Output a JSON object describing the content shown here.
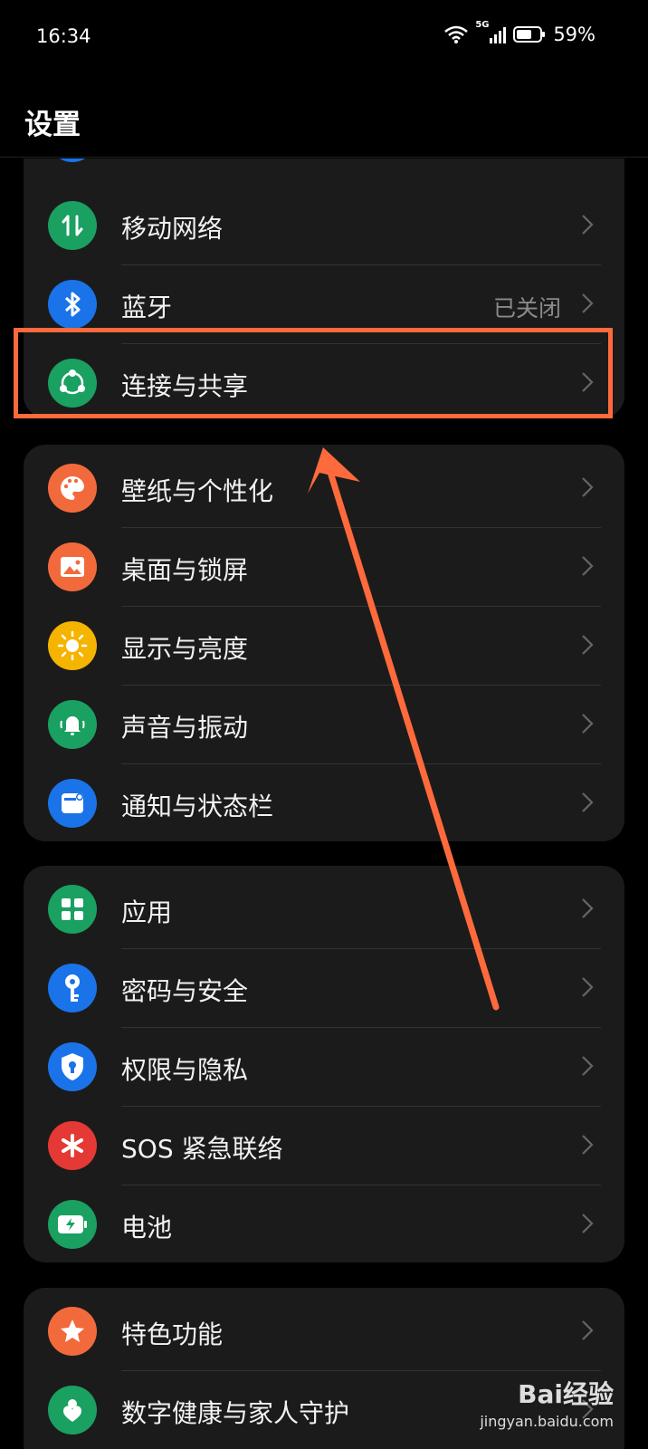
{
  "status_bar": {
    "time": "16:34",
    "network": "5G",
    "battery": "59%"
  },
  "header": {
    "title": "设置"
  },
  "groups": [
    {
      "items": [
        {
          "label": "移动网络",
          "value": "",
          "icon": "mobile-data-icon",
          "color": "#1aa060"
        },
        {
          "label": "蓝牙",
          "value": "已关闭",
          "icon": "bluetooth-icon",
          "color": "#1a73e8"
        },
        {
          "label": "连接与共享",
          "value": "",
          "icon": "share-connection-icon",
          "color": "#1aa060"
        }
      ]
    },
    {
      "items": [
        {
          "label": "壁纸与个性化",
          "icon": "palette-icon",
          "color": "#f26a3c"
        },
        {
          "label": "桌面与锁屏",
          "icon": "picture-icon",
          "color": "#f26a3c"
        },
        {
          "label": "显示与亮度",
          "icon": "sun-icon",
          "color": "#f5b400"
        },
        {
          "label": "声音与振动",
          "icon": "bell-icon",
          "color": "#1aa060"
        },
        {
          "label": "通知与状态栏",
          "icon": "notification-icon",
          "color": "#1a73e8"
        }
      ]
    },
    {
      "items": [
        {
          "label": "应用",
          "icon": "apps-grid-icon",
          "color": "#1aa060"
        },
        {
          "label": "密码与安全",
          "icon": "key-icon",
          "color": "#1a73e8"
        },
        {
          "label": "权限与隐私",
          "icon": "shield-lock-icon",
          "color": "#1a73e8"
        },
        {
          "label": "SOS 紧急联络",
          "icon": "sos-asterisk-icon",
          "color": "#e53935"
        },
        {
          "label": "电池",
          "icon": "battery-icon",
          "color": "#1aa060"
        }
      ]
    },
    {
      "items": [
        {
          "label": "特色功能",
          "icon": "star-icon",
          "color": "#f26a3c"
        },
        {
          "label": "数字健康与家人守护",
          "icon": "wellbeing-icon",
          "color": "#1aa060"
        }
      ]
    }
  ],
  "watermark": {
    "brand": "Bai经验",
    "url": "jingyan.baidu.com"
  }
}
